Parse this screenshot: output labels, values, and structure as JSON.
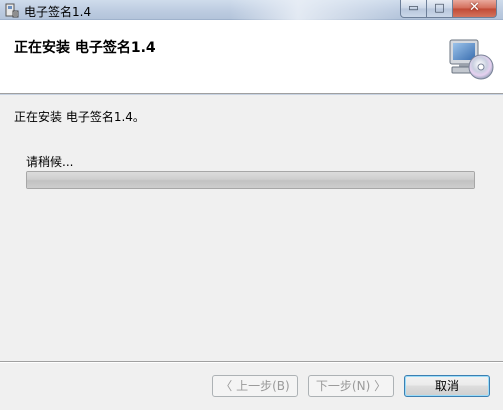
{
  "window": {
    "title": "电子签名1.4",
    "icon": "installer-icon",
    "controls": {
      "minimize": "▭",
      "maximize": "□",
      "close": "✕"
    }
  },
  "header": {
    "title": "正在安装 电子签名1.4",
    "icon": "computer-disc-icon"
  },
  "content": {
    "status": "正在安装 电子签名1.4。",
    "wait_label": "请稍候...",
    "progress": 0.0
  },
  "footer": {
    "back_label": "〈 上一步(B)",
    "next_label": "下一步(N) 〉",
    "cancel_label": "取消"
  },
  "colors": {
    "title_bar": "#bccbe0",
    "close_button": "#c14a35",
    "default_button_border": "#3c7fb1"
  }
}
